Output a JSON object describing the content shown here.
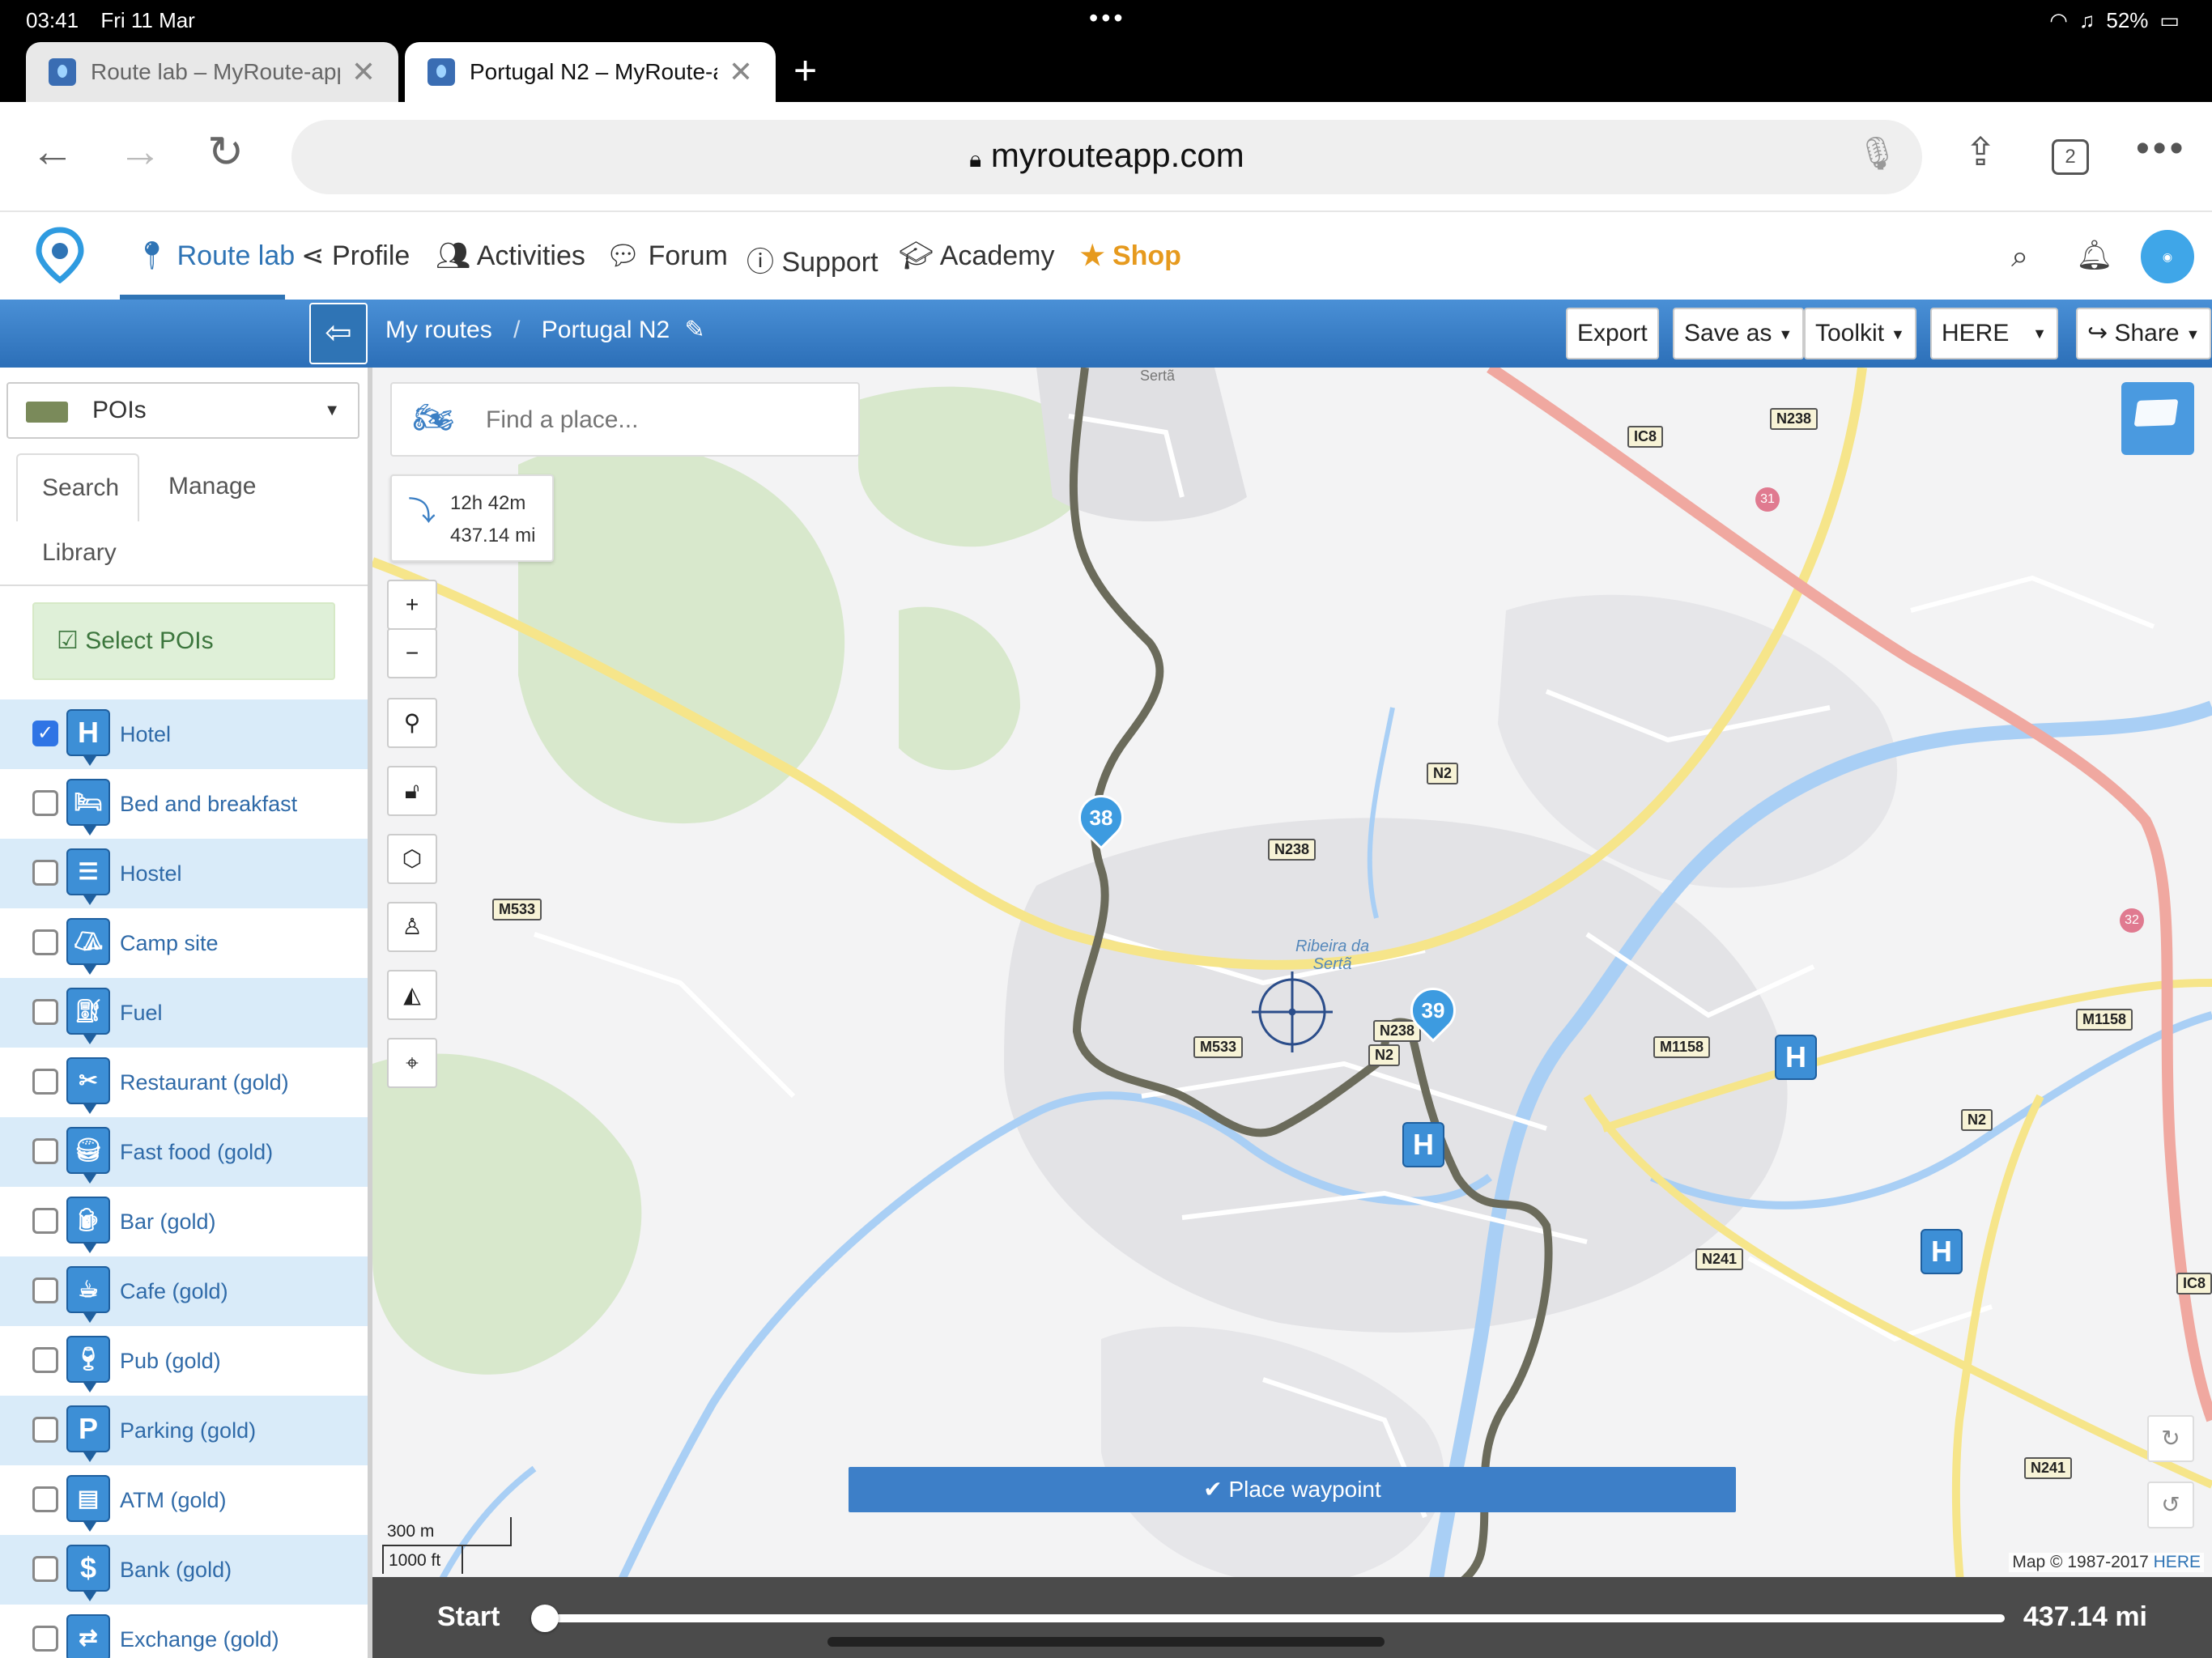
{
  "status": {
    "time": "03:41",
    "date": "Fri 11 Mar",
    "battery": "52%"
  },
  "tabs": [
    {
      "title": "Route lab – MyRoute-app"
    },
    {
      "title": "Portugal N2 – MyRoute-app"
    }
  ],
  "browser": {
    "url": "myrouteapp.com",
    "tab_count": "2"
  },
  "nav": {
    "items": [
      "Route lab",
      "Profile",
      "Activities",
      "Forum",
      "Support",
      "Academy",
      "Shop"
    ],
    "active": "Route lab"
  },
  "toolbar": {
    "breadcrumb": [
      "My routes",
      "Portugal N2"
    ],
    "buttons": {
      "export": "Export",
      "save_as": "Save as",
      "toolkit": "Toolkit",
      "map_provider": "HERE",
      "share": "Share"
    }
  },
  "panel": {
    "select_label": "POIs",
    "tabs": {
      "search": "Search",
      "manage": "Manage",
      "library": "Library"
    },
    "select_pois": "Select POIs",
    "poi_items": [
      {
        "name": "Hotel",
        "checked": true,
        "glyph": "H"
      },
      {
        "name": "Bed and breakfast",
        "checked": false,
        "glyph": "bed-icon"
      },
      {
        "name": "Hostel",
        "checked": false,
        "glyph": "hostel-icon"
      },
      {
        "name": "Camp site",
        "checked": false,
        "glyph": "tent-icon"
      },
      {
        "name": "Fuel",
        "checked": false,
        "glyph": "fuel-icon"
      },
      {
        "name": "Restaurant (gold)",
        "checked": false,
        "glyph": "cutlery-icon"
      },
      {
        "name": "Fast food (gold)",
        "checked": false,
        "glyph": "fastfood-icon"
      },
      {
        "name": "Bar (gold)",
        "checked": false,
        "glyph": "beer-icon"
      },
      {
        "name": "Cafe (gold)",
        "checked": false,
        "glyph": "coffee-icon"
      },
      {
        "name": "Pub (gold)",
        "checked": false,
        "glyph": "pub-icon"
      },
      {
        "name": "Parking (gold)",
        "checked": false,
        "glyph": "P"
      },
      {
        "name": "ATM (gold)",
        "checked": false,
        "glyph": "atm-icon"
      },
      {
        "name": "Bank (gold)",
        "checked": false,
        "glyph": "$"
      },
      {
        "name": "Exchange (gold)",
        "checked": false,
        "glyph": "exchange-icon"
      }
    ]
  },
  "map": {
    "search_placeholder": "Find a place...",
    "route_time": "12h 42m",
    "route_distance": "437.14 mi",
    "place_waypoint": "Place waypoint",
    "scale_metric": "300 m",
    "scale_imperial": "1000 ft",
    "attribution": "Map © 1987-2017",
    "attribution_link": "HERE",
    "road_labels": [
      "N238",
      "IC8",
      "31",
      "N2",
      "M533",
      "N238",
      "M533",
      "N238",
      "N2",
      "M1158",
      "32",
      "M1158",
      "N2",
      "N241",
      "IC8",
      "N241",
      "N2"
    ],
    "place_labels": [
      "Ribeira da",
      "Sertã",
      "Sertã"
    ],
    "waypoints": [
      "38",
      "39"
    ],
    "hotel_markers": [
      "H",
      "H",
      "H"
    ]
  },
  "bottom": {
    "start": "Start",
    "end_distance": "437.14 mi",
    "slider_position": 0
  }
}
